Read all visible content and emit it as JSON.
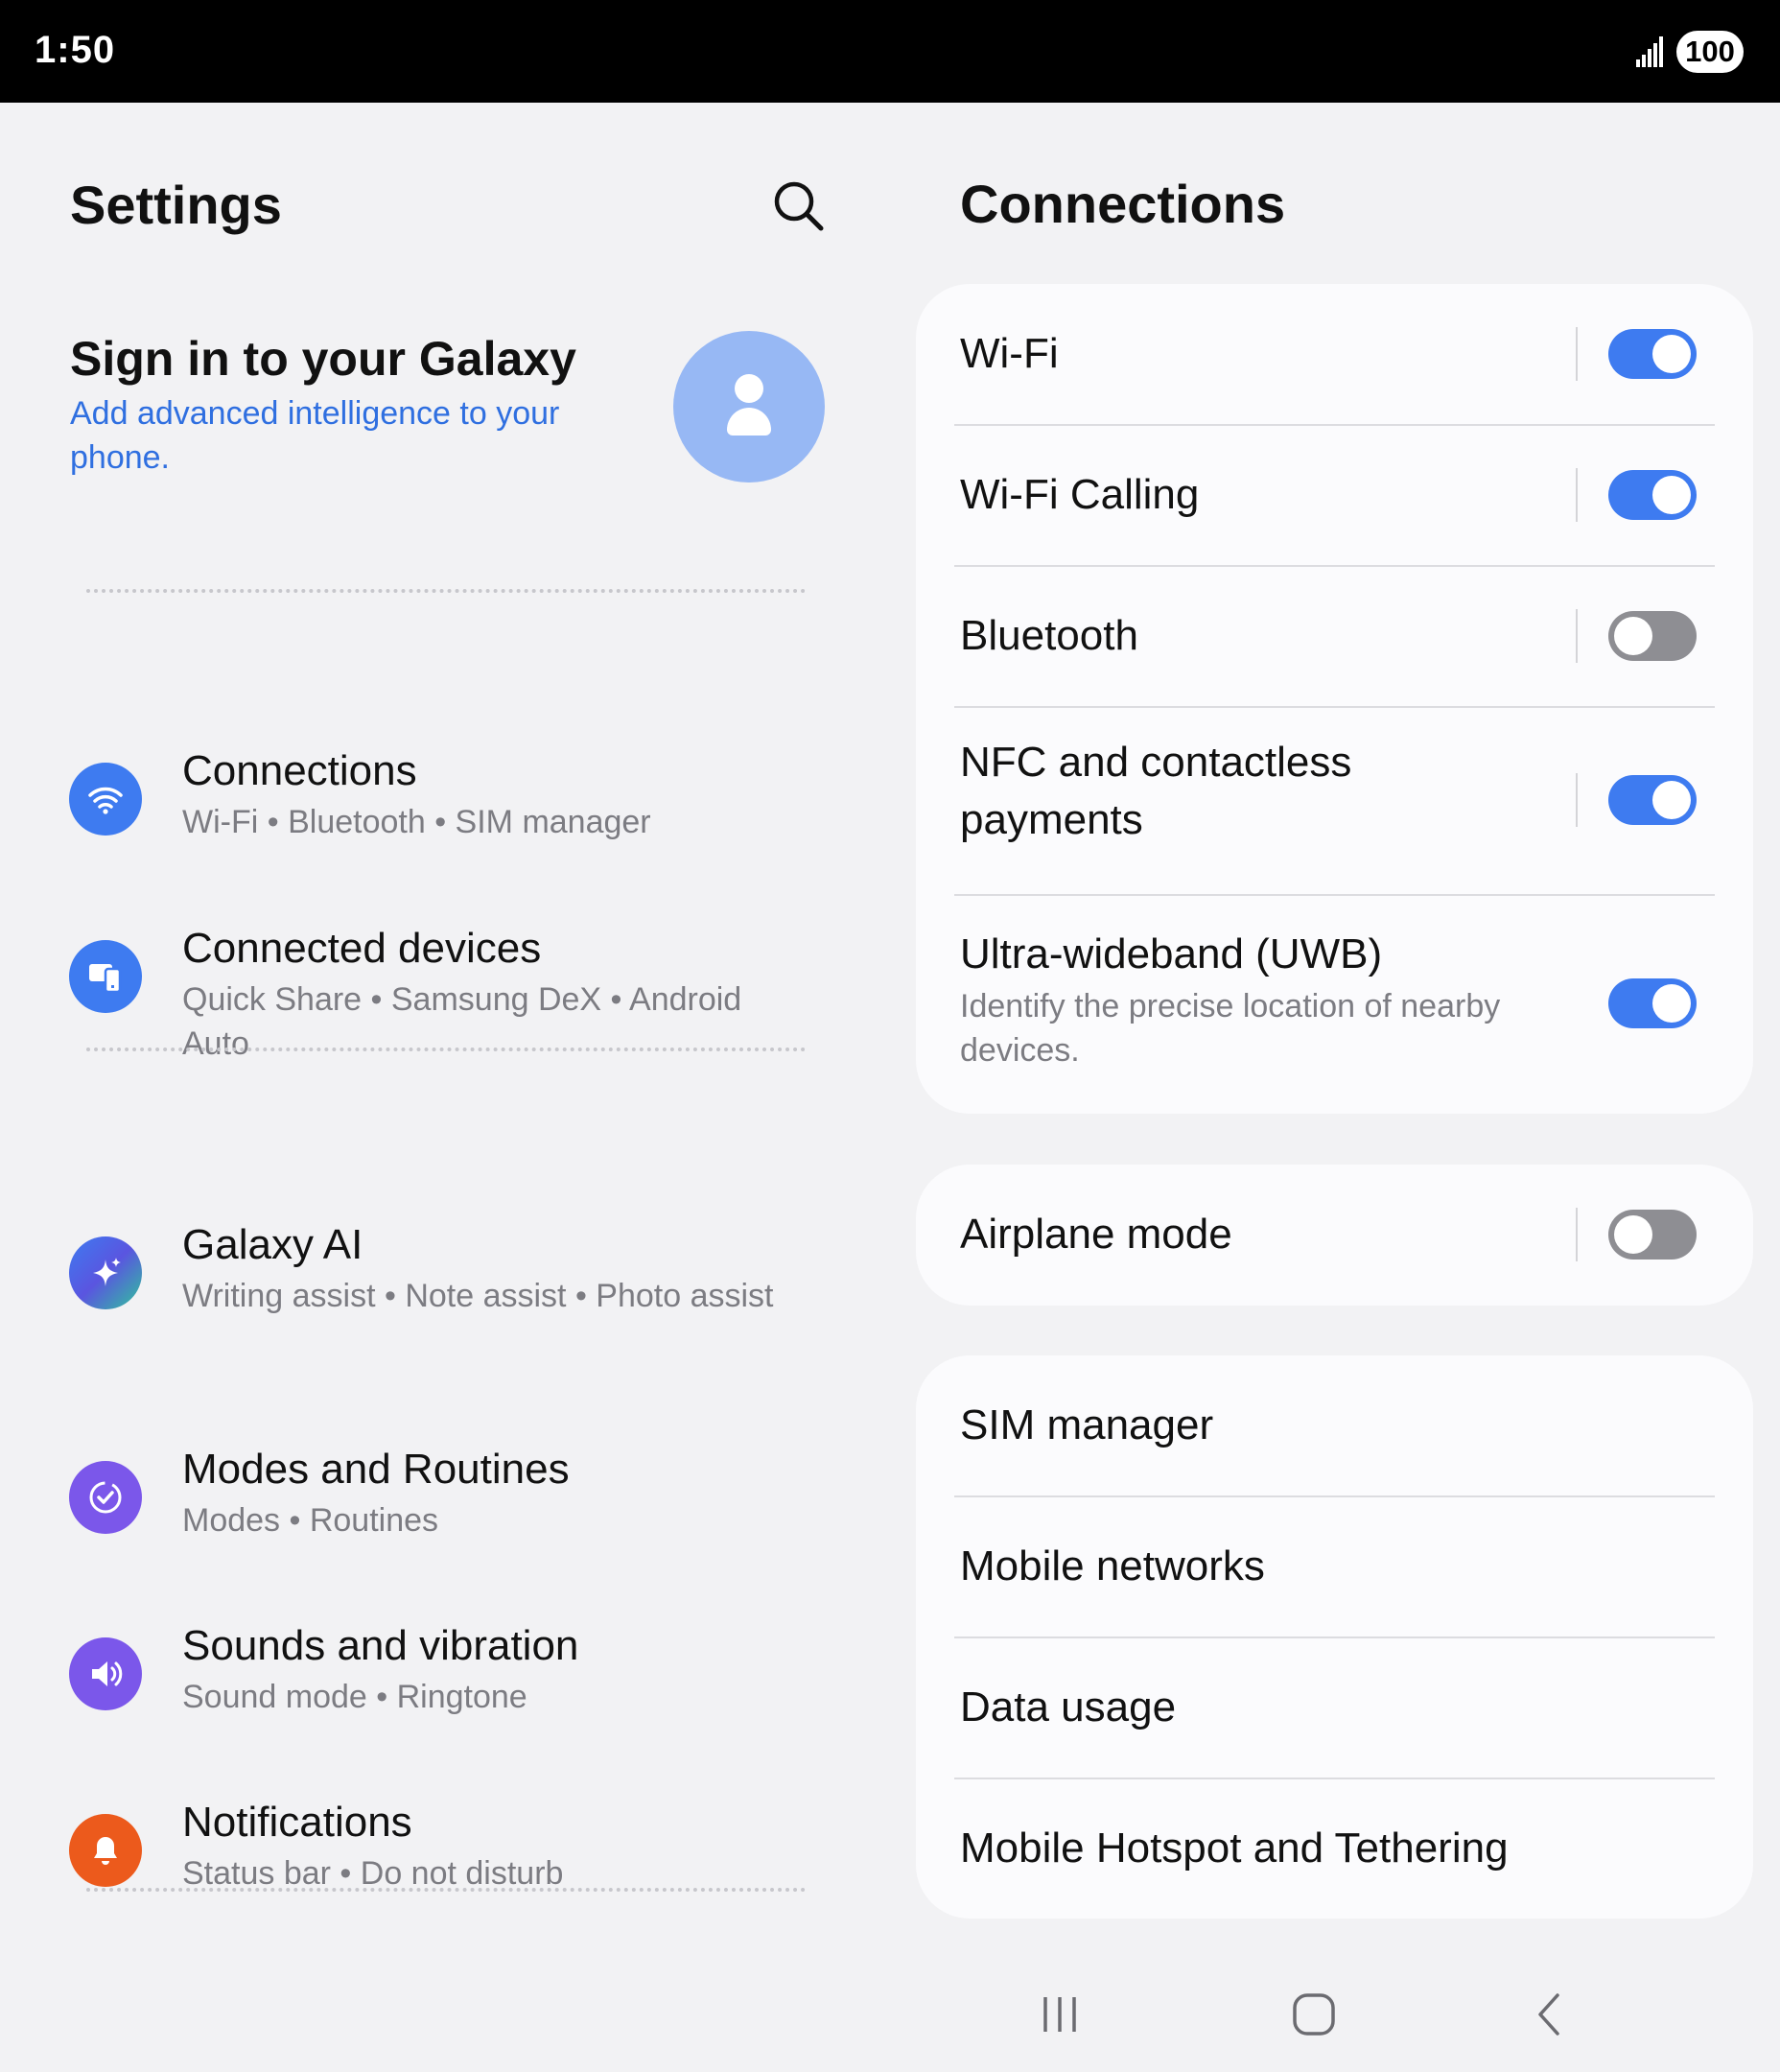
{
  "status_bar": {
    "time": "1:50",
    "battery": "100"
  },
  "left": {
    "title": "Settings",
    "signin": {
      "title": "Sign in to your Galaxy",
      "subtitle": "Add advanced intelligence to your phone."
    },
    "items": [
      {
        "title": "Connections",
        "subtitle": "Wi-Fi  •  Bluetooth  •  SIM manager",
        "icon": "wifi-icon",
        "color": "#3e7bf0"
      },
      {
        "title": "Connected devices",
        "subtitle": "Quick Share  •  Samsung DeX  •  Android Auto",
        "icon": "connected-devices-icon",
        "color": "#3e7bf0"
      },
      {
        "title": "Galaxy AI",
        "subtitle": "Writing assist  •  Note assist  •  Photo assist",
        "icon": "sparkle-icon",
        "color": "#4a63e8"
      },
      {
        "title": "Modes and Routines",
        "subtitle": "Modes  •  Routines",
        "icon": "routine-check-icon",
        "color": "#7b57ea"
      },
      {
        "title": "Sounds and vibration",
        "subtitle": "Sound mode  •  Ringtone",
        "icon": "speaker-icon",
        "color": "#7b57ea"
      },
      {
        "title": "Notifications",
        "subtitle": "Status bar  •  Do not disturb",
        "icon": "bell-icon",
        "color": "#ec5a1c"
      }
    ]
  },
  "right": {
    "title": "Connections",
    "group1": [
      {
        "label": "Wi-Fi",
        "toggle": true
      },
      {
        "label": "Wi-Fi Calling",
        "toggle": true
      },
      {
        "label": "Bluetooth",
        "toggle": false
      },
      {
        "label": "NFC and contactless payments",
        "toggle": true
      },
      {
        "label": "Ultra-wideband (UWB)",
        "desc": "Identify the precise location of nearby devices.",
        "toggle": true
      }
    ],
    "group2": [
      {
        "label": "Airplane mode",
        "toggle": false
      }
    ],
    "group3": [
      {
        "label": "SIM manager"
      },
      {
        "label": "Mobile networks"
      },
      {
        "label": "Data usage"
      },
      {
        "label": "Mobile Hotspot and Tethering"
      }
    ]
  },
  "colors": {
    "accent": "#3e7bf0",
    "link": "#2f6fe0",
    "toggle_off": "#8e8e93"
  }
}
